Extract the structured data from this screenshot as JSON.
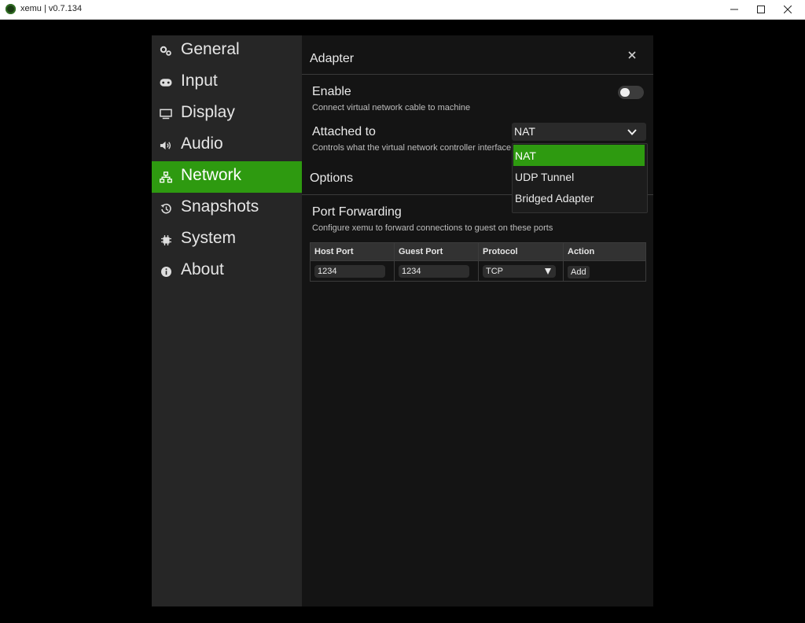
{
  "window": {
    "title": "xemu | v0.7.134"
  },
  "sidebar": {
    "items": [
      {
        "label": "General",
        "icon": "gears-icon"
      },
      {
        "label": "Input",
        "icon": "gamepad-icon"
      },
      {
        "label": "Display",
        "icon": "monitor-icon"
      },
      {
        "label": "Audio",
        "icon": "speaker-icon"
      },
      {
        "label": "Network",
        "icon": "network-icon",
        "active": true
      },
      {
        "label": "Snapshots",
        "icon": "history-icon"
      },
      {
        "label": "System",
        "icon": "chip-icon"
      },
      {
        "label": "About",
        "icon": "info-icon"
      }
    ]
  },
  "adapter": {
    "title": "Adapter",
    "enable": {
      "label": "Enable",
      "desc": "Connect virtual network cable to machine",
      "value": false
    },
    "attached_to": {
      "label": "Attached to",
      "desc": "Controls what the virtual network controller interface is attached to",
      "value": "NAT",
      "options": [
        "NAT",
        "UDP Tunnel",
        "Bridged Adapter"
      ]
    }
  },
  "options": {
    "title": "Options",
    "port_forwarding": {
      "label": "Port Forwarding",
      "desc": "Configure xemu to forward connections to guest on these ports",
      "columns": [
        "Host Port",
        "Guest Port",
        "Protocol",
        "Action"
      ],
      "row": {
        "host_port": "1234",
        "guest_port": "1234",
        "protocol": "TCP",
        "action": "Add"
      }
    }
  },
  "colors": {
    "accent": "#2e9a10",
    "background": "#141414",
    "sidebar": "#262626"
  }
}
